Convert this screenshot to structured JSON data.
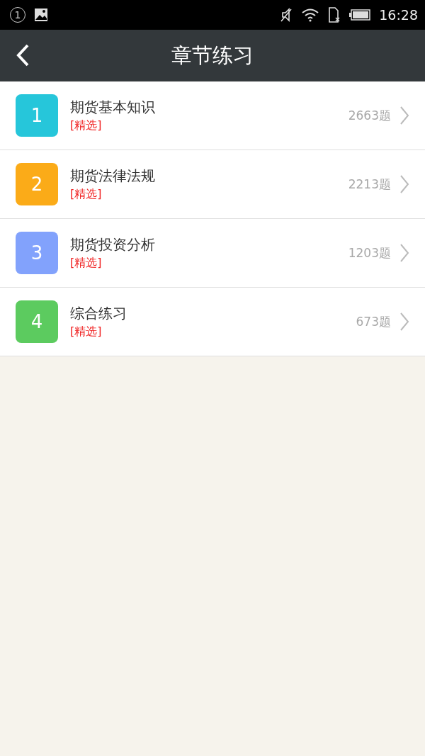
{
  "status_bar": {
    "notification_count": "1",
    "time": "16:28"
  },
  "header": {
    "title": "章节练习"
  },
  "chapters": [
    {
      "number": "1",
      "title": "期货基本知识",
      "tag": "[精选]",
      "count": "2663题",
      "color": "#26c6da"
    },
    {
      "number": "2",
      "title": "期货法律法规",
      "tag": "[精选]",
      "count": "2213题",
      "color": "#fbab18"
    },
    {
      "number": "3",
      "title": "期货投资分析",
      "tag": "[精选]",
      "count": "1203题",
      "color": "#82a2fc"
    },
    {
      "number": "4",
      "title": "综合练习",
      "tag": "[精选]",
      "count": "673题",
      "color": "#5ccb5f"
    }
  ]
}
